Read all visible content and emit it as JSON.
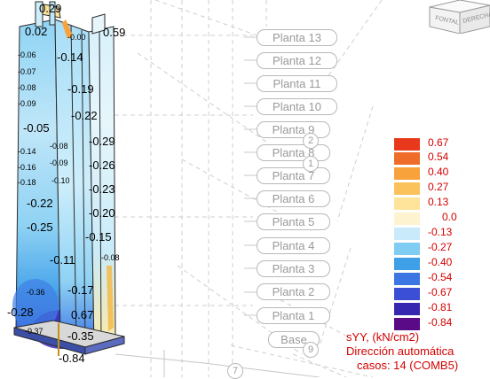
{
  "floors": [
    {
      "label": "Planta 13"
    },
    {
      "label": "Planta 12"
    },
    {
      "label": "Planta 11"
    },
    {
      "label": "Planta 10"
    },
    {
      "label": "Planta 9"
    },
    {
      "label": "Planta 8"
    },
    {
      "label": "Planta 7"
    },
    {
      "label": "Planta 6"
    },
    {
      "label": "Planta 5"
    },
    {
      "label": "Planta 4"
    },
    {
      "label": "Planta 3"
    },
    {
      "label": "Planta 2"
    },
    {
      "label": "Planta 1"
    },
    {
      "label": "Base"
    }
  ],
  "grid_bubbles": [
    "2",
    "1",
    "9",
    "7"
  ],
  "viewcube": {
    "left": "FONTAL",
    "right": "DERECHA"
  },
  "values_left": [
    "0.29",
    "0.02",
    "-0.06",
    "-0.07",
    "-0.08",
    "-0.09",
    "-0.05",
    "-0.14",
    "-0.16",
    "-0.18",
    "-0.22",
    "-0.25",
    "-0.36",
    "-0.28",
    "-0.37"
  ],
  "values_mid": [
    "-0.00",
    "-0.08",
    "-0.09",
    "-0.10",
    "-0.11",
    "-0.84"
  ],
  "values_right": [
    "0.59",
    "-0.14",
    "-0.19",
    "-0.22",
    "-0.29",
    "-0.26",
    "-0.23",
    "-0.20",
    "-0.15",
    "-0.08",
    "-0.17",
    "0.67",
    "-0.35"
  ],
  "legend": {
    "entries": [
      {
        "label": "0.67",
        "color": "#e8391c"
      },
      {
        "label": "0.54",
        "color": "#f06c2a"
      },
      {
        "label": "0.40",
        "color": "#f7a23a"
      },
      {
        "label": "0.27",
        "color": "#fbc25b"
      },
      {
        "label": "0.13",
        "color": "#fde49a"
      },
      {
        "label": "0.0",
        "color": "#fdf3d0"
      },
      {
        "label": "-0.13",
        "color": "#c8eafb"
      },
      {
        "label": "-0.27",
        "color": "#7fcdf3"
      },
      {
        "label": "-0.40",
        "color": "#3fa0e8"
      },
      {
        "label": "-0.54",
        "color": "#3b76e2"
      },
      {
        "label": "-0.67",
        "color": "#3a4fd6"
      },
      {
        "label": "-0.81",
        "color": "#3627b0"
      },
      {
        "label": "-0.84",
        "color": "#5a0a86"
      }
    ],
    "title": "sYY, (kN/cm2)",
    "subtitle": "Dirección automática",
    "case": "casos: 14 (COMB5)"
  }
}
